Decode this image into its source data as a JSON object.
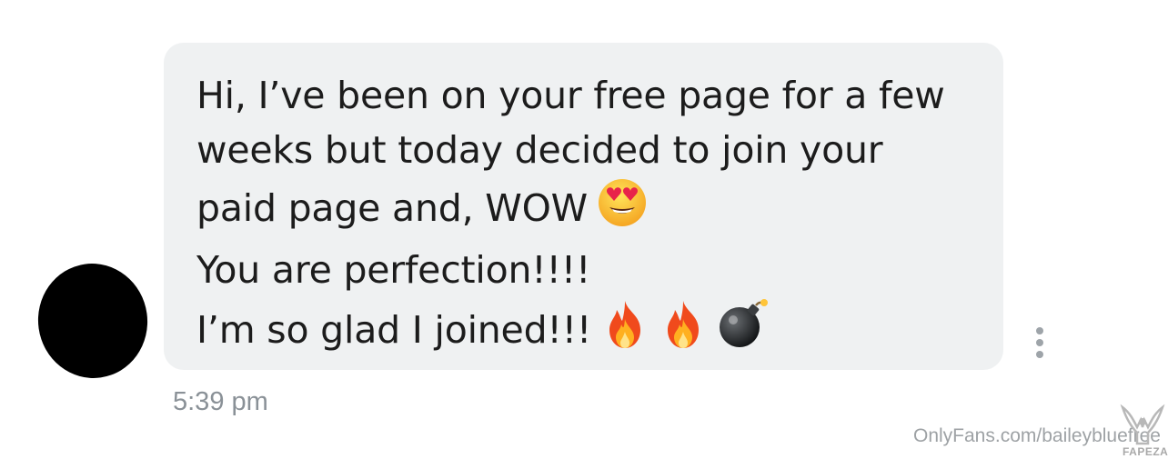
{
  "message": {
    "lines": [
      "Hi, I’ve been on your free page for a few",
      "weeks but today decided to join your",
      "paid page and, WOW",
      "You are perfection!!!!",
      "I’m so glad I joined!!!"
    ],
    "emoji_line3": [
      "smiling-face-with-heart-eyes"
    ],
    "emoji_line5": [
      "fire",
      "fire",
      "bomb"
    ],
    "timestamp": "5:39 pm"
  },
  "colors": {
    "bubble": "#eff1f2",
    "text": "#1c1c1c",
    "timestamp": "#8a9197",
    "avatar": "#000000",
    "more_dots": "#9ea4a9"
  },
  "watermark": {
    "text": "OnlyFans.com/baileybluefree",
    "logo_text": "FAPEZA"
  },
  "icons": {
    "more": "vertical-ellipsis-icon"
  }
}
